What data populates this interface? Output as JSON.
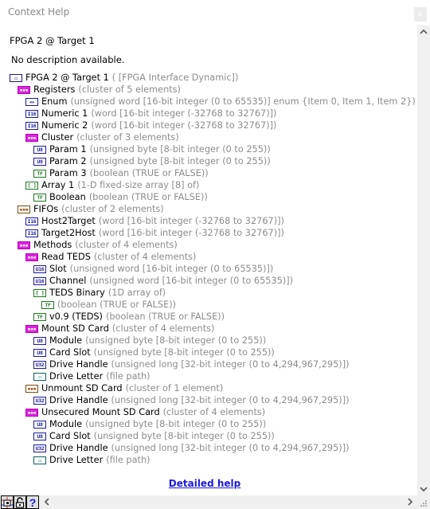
{
  "window": {
    "title": "Context Help",
    "close_label": "x"
  },
  "header": {
    "heading": "FPGA 2 @ Target 1",
    "description": "No description available."
  },
  "tree": [
    {
      "depth": 0,
      "icon": "fpga-target-icon",
      "icon_style": "ctrl",
      "glyph": "▭",
      "name": "FPGA 2 @ Target 1",
      "type": "( [FPGA Interface Dynamic])"
    },
    {
      "depth": 1,
      "icon": "cluster-icon",
      "icon_style": "pink",
      "glyph": "▪▪▪",
      "name": "Registers",
      "type": "(cluster of 5 elements)"
    },
    {
      "depth": 2,
      "icon": "enum-icon",
      "icon_style": "blue",
      "glyph": "◂▸",
      "name": "Enum",
      "type": "(unsigned word [16-bit integer (0 to 65535)] enum {Item 0, Item 1, Item 2})"
    },
    {
      "depth": 2,
      "icon": "i16-icon",
      "icon_style": "blue",
      "glyph": "I16",
      "name": "Numeric 1",
      "type": "(word [16-bit integer (-32768 to 32767)])"
    },
    {
      "depth": 2,
      "icon": "i16-icon",
      "icon_style": "blue",
      "glyph": "I16",
      "name": "Numeric 2",
      "type": "(word [16-bit integer (-32768 to 32767)])"
    },
    {
      "depth": 2,
      "icon": "cluster-icon",
      "icon_style": "pink",
      "glyph": "▪▪▪",
      "name": "Cluster",
      "type": "(cluster of 3 elements)"
    },
    {
      "depth": 3,
      "icon": "u8-icon",
      "icon_style": "blue",
      "glyph": "U8",
      "name": "Param 1",
      "type": "(unsigned byte [8-bit integer (0 to 255))"
    },
    {
      "depth": 3,
      "icon": "u8-icon",
      "icon_style": "blue",
      "glyph": "U8",
      "name": "Param 2",
      "type": "(unsigned byte [8-bit integer (0 to 255))"
    },
    {
      "depth": 3,
      "icon": "boolean-icon",
      "icon_style": "green",
      "glyph": "TF",
      "name": "Param 3",
      "type": "(boolean (TRUE or FALSE))"
    },
    {
      "depth": 2,
      "icon": "array-icon",
      "icon_style": "green",
      "glyph": "[ ]",
      "name": "Array 1",
      "type": "(1-D fixed-size array [8] of)"
    },
    {
      "depth": 3,
      "icon": "boolean-icon",
      "icon_style": "green",
      "glyph": "TF",
      "name": "Boolean",
      "type": "(boolean (TRUE or FALSE))"
    },
    {
      "depth": 1,
      "icon": "cluster-icon",
      "icon_style": "brown",
      "glyph": "▪▪▪",
      "name": "FIFOs",
      "type": "(cluster of 2 elements)"
    },
    {
      "depth": 2,
      "icon": "i16-icon",
      "icon_style": "blue",
      "glyph": "I16",
      "name": "Host2Target",
      "type": "(word [16-bit integer (-32768 to 32767)])"
    },
    {
      "depth": 2,
      "icon": "i16-icon",
      "icon_style": "blue",
      "glyph": "I16",
      "name": "Target2Host",
      "type": "(word [16-bit integer (-32768 to 32767)])"
    },
    {
      "depth": 1,
      "icon": "cluster-icon",
      "icon_style": "pink",
      "glyph": "▪▪▪",
      "name": "Methods",
      "type": "(cluster of 4 elements)"
    },
    {
      "depth": 2,
      "icon": "cluster-icon",
      "icon_style": "pink",
      "glyph": "▪▪▪",
      "name": "Read TEDS",
      "type": "(cluster of 4 elements)"
    },
    {
      "depth": 3,
      "icon": "u16-icon",
      "icon_style": "blue",
      "glyph": "U16",
      "name": "Slot",
      "type": "(unsigned word [16-bit integer (0 to 65535)])"
    },
    {
      "depth": 3,
      "icon": "u16-icon",
      "icon_style": "blue",
      "glyph": "U16",
      "name": "Channel",
      "type": "(unsigned word [16-bit integer (0 to 65535)])"
    },
    {
      "depth": 3,
      "icon": "array-icon",
      "icon_style": "green",
      "glyph": "[ ]",
      "name": "TEDS Binary",
      "type": "(1D array of)"
    },
    {
      "depth": 4,
      "icon": "boolean-icon",
      "icon_style": "green",
      "glyph": "TF",
      "name": "",
      "type": "(boolean (TRUE or FALSE))"
    },
    {
      "depth": 3,
      "icon": "boolean-icon",
      "icon_style": "green",
      "glyph": "TF",
      "name": "v0.9 (TEDS)",
      "type": "(boolean (TRUE or FALSE))"
    },
    {
      "depth": 2,
      "icon": "cluster-icon",
      "icon_style": "pink",
      "glyph": "▪▪▪",
      "name": "Mount SD Card",
      "type": "(cluster of 4 elements)"
    },
    {
      "depth": 3,
      "icon": "u8-icon",
      "icon_style": "blue",
      "glyph": "U8",
      "name": "Module",
      "type": "(unsigned byte [8-bit integer (0 to 255))"
    },
    {
      "depth": 3,
      "icon": "u8-icon",
      "icon_style": "blue",
      "glyph": "U8",
      "name": "Card Slot",
      "type": "(unsigned byte [8-bit integer (0 to 255))"
    },
    {
      "depth": 3,
      "icon": "u32-icon",
      "icon_style": "blue",
      "glyph": "U32",
      "name": "Drive Handle",
      "type": "(unsigned long [32-bit integer (0 to 4,294,967,295)])"
    },
    {
      "depth": 3,
      "icon": "path-icon",
      "icon_style": "teal",
      "glyph": "▭",
      "name": "Drive Letter",
      "type": "(file path)"
    },
    {
      "depth": 2,
      "icon": "cluster-icon",
      "icon_style": "brown",
      "glyph": "▪▪▪",
      "name": "Unmount SD Card",
      "type": "(cluster of 1 element)"
    },
    {
      "depth": 3,
      "icon": "u32-icon",
      "icon_style": "blue",
      "glyph": "U32",
      "name": "Drive Handle",
      "type": "(unsigned long [32-bit integer (0 to 4,294,967,295)])"
    },
    {
      "depth": 2,
      "icon": "cluster-icon",
      "icon_style": "pink",
      "glyph": "▪▪▪",
      "name": "Unsecured Mount SD Card",
      "type": "(cluster of 4 elements)"
    },
    {
      "depth": 3,
      "icon": "u8-icon",
      "icon_style": "blue",
      "glyph": "U8",
      "name": "Module",
      "type": "(unsigned byte [8-bit integer (0 to 255))"
    },
    {
      "depth": 3,
      "icon": "u8-icon",
      "icon_style": "blue",
      "glyph": "U8",
      "name": "Card Slot",
      "type": "(unsigned byte [8-bit integer (0 to 255))"
    },
    {
      "depth": 3,
      "icon": "u32-icon",
      "icon_style": "blue",
      "glyph": "U32",
      "name": "Drive Handle",
      "type": "(unsigned long [32-bit integer (0 to 4,294,967,295)])"
    },
    {
      "depth": 3,
      "icon": "path-icon",
      "icon_style": "teal",
      "glyph": "▭",
      "name": "Drive Letter",
      "type": "(file path)"
    }
  ],
  "footer": {
    "detailed_help_link": "Detailed help",
    "tools": [
      {
        "name": "show-optional-terminals-button",
        "glyph": "⊕"
      },
      {
        "name": "lock-button",
        "glyph": "🔓"
      },
      {
        "name": "detailed-help-button",
        "glyph": "?"
      }
    ]
  },
  "scrollbars": {
    "up": "⌃",
    "down": "⌄",
    "left": "‹",
    "right": "›"
  }
}
